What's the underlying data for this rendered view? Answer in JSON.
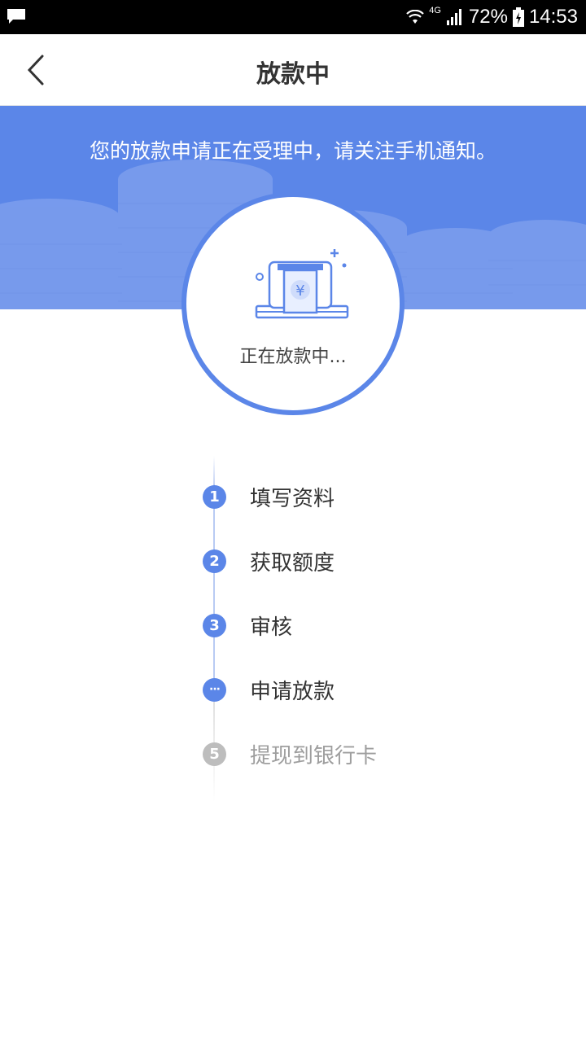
{
  "status_bar": {
    "network": "4G",
    "battery": "72%",
    "time": "14:53"
  },
  "header": {
    "title": "放款中"
  },
  "banner": {
    "notice": "您的放款申请正在受理中，请关注手机通知。"
  },
  "status_card": {
    "icon": "atm-cash-icon",
    "status_text": "正在放款中..."
  },
  "steps": [
    {
      "marker": "1",
      "label": "填写资料",
      "state": "done"
    },
    {
      "marker": "2",
      "label": "获取额度",
      "state": "done"
    },
    {
      "marker": "3",
      "label": "审核",
      "state": "done"
    },
    {
      "marker": "···",
      "label": "申请放款",
      "state": "current"
    },
    {
      "marker": "5",
      "label": "提现到银行卡",
      "state": "pending"
    }
  ],
  "colors": {
    "accent": "#5b86e8",
    "pending": "#bdbdbd",
    "text": "#333333"
  }
}
